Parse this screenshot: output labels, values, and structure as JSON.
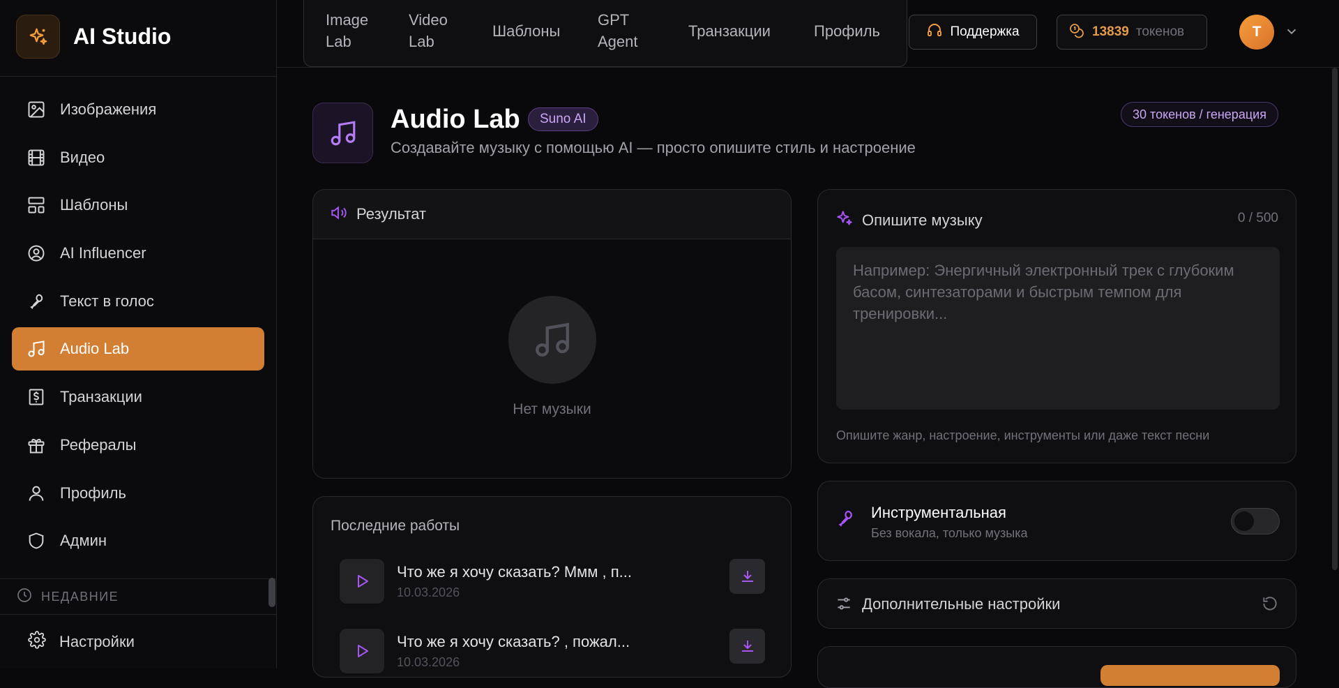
{
  "brand": {
    "title": "AI Studio"
  },
  "sidebar": {
    "items": [
      {
        "label": "Изображения",
        "icon": "image-icon"
      },
      {
        "label": "Видео",
        "icon": "film-icon"
      },
      {
        "label": "Шаблоны",
        "icon": "layout-icon"
      },
      {
        "label": "AI Influencer",
        "icon": "user-circle-icon"
      },
      {
        "label": "Текст в голос",
        "icon": "microphone-icon"
      },
      {
        "label": "Audio Lab",
        "icon": "music-icon",
        "active": true
      },
      {
        "label": "Транзакции",
        "icon": "dollar-receipt-icon"
      },
      {
        "label": "Рефералы",
        "icon": "gift-icon"
      },
      {
        "label": "Профиль",
        "icon": "user-icon"
      },
      {
        "label": "Админ",
        "icon": "shield-icon"
      }
    ],
    "recent_label": "НЕДАВНИЕ",
    "settings_label": "Настройки"
  },
  "topbar": {
    "tabs": [
      {
        "line1": "Image",
        "line2": "Lab"
      },
      {
        "line1": "Video",
        "line2": "Lab"
      },
      {
        "line1": "Шаблоны",
        "line2": ""
      },
      {
        "line1": "GPT",
        "line2": "Agent"
      },
      {
        "line1": "Транзакции",
        "line2": ""
      },
      {
        "line1": "Профиль",
        "line2": ""
      }
    ],
    "support_label": "Поддержка",
    "tokens_value": "13839",
    "tokens_unit": "токенов",
    "avatar_letter": "T"
  },
  "header": {
    "title": "Audio Lab",
    "badge": "Suno AI",
    "subtitle": "Создавайте музыку с помощью AI — просто опишите стиль и настроение",
    "cost": "30 токенов / генерация"
  },
  "result": {
    "title": "Результат",
    "empty_text": "Нет музыки"
  },
  "recent_works": {
    "title": "Последние работы",
    "items": [
      {
        "title": "Что же я хочу сказать? Ммм , п...",
        "date": "10.03.2026"
      },
      {
        "title": "Что же я хочу сказать? , пожал...",
        "date": "10.03.2026"
      }
    ]
  },
  "describe": {
    "title": "Опишите музыку",
    "counter": "0 / 500",
    "placeholder": "Например: Энергичный электронный трек с глубоким басом, синтезаторами и быстрым темпом для тренировки...",
    "hint": "Опишите жанр, настроение, инструменты или даже текст песни"
  },
  "instrumental": {
    "title": "Инструментальная",
    "subtitle": "Без вокала, только музыка",
    "enabled": false
  },
  "advanced": {
    "title": "Дополнительные настройки"
  },
  "colors": {
    "accent": "#d27f33",
    "purple": "#a855f7",
    "background": "#09090b"
  }
}
